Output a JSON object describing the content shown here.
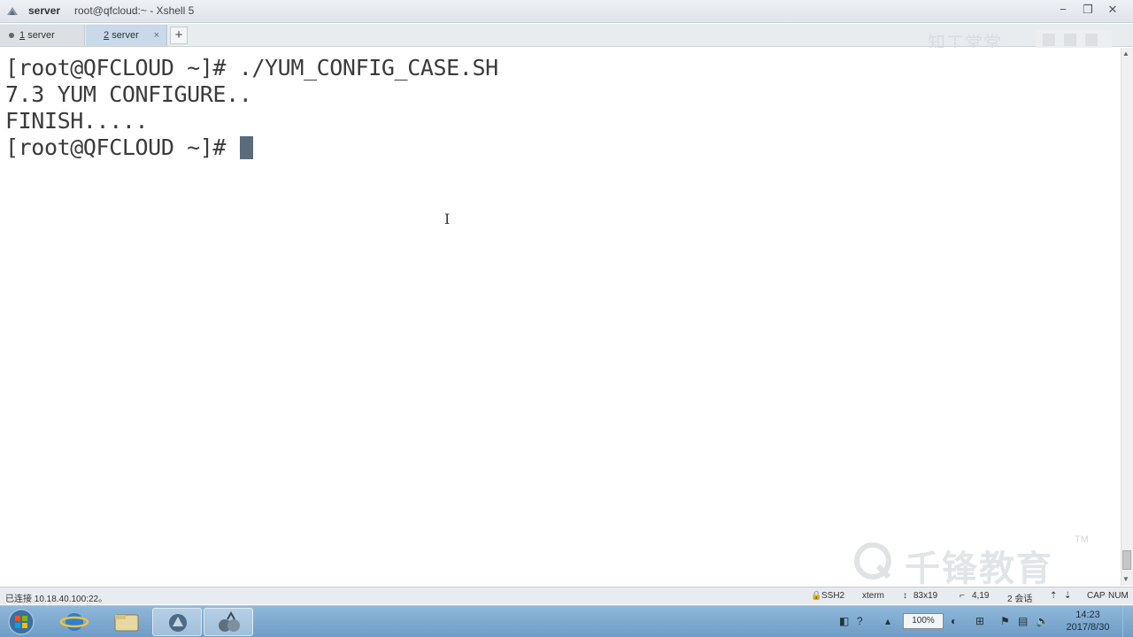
{
  "titlebar": {
    "app_name": "server",
    "window_title": "root@qfcloud:~ - Xshell 5",
    "minimize": "−",
    "restore": "❐",
    "close": "✕"
  },
  "tabs": [
    {
      "num": "1",
      "label": "server"
    },
    {
      "num": "2",
      "label": "server",
      "close": "×"
    }
  ],
  "tab_add": "+",
  "watermark_top": "知工堂堂",
  "terminal": {
    "lines": [
      "[root@QFCLOUD ~]# ./YUM_CONFIG_CASE.SH",
      "7.3 YUM CONFIGURE..",
      "FINISH.....",
      "[root@QFCLOUD ~]# "
    ]
  },
  "watermark_bottom": {
    "text": "千锋教育",
    "tm": "TM"
  },
  "statusbar": {
    "connection": "已连接 10.18.40.100:22。",
    "protocol": "SSH2",
    "term": "xterm",
    "size": "83x19",
    "cursor_pos": "4,19",
    "sessions": "2 会话",
    "caps": "CAP",
    "num": "NUM"
  },
  "taskbar": {
    "zoom": "100%",
    "time": "14:23",
    "date": "2017/8/30"
  },
  "colors": {
    "taskbar": "#7aa6cf",
    "cursor": "#5b6b7b",
    "terminal_text": "#3b3b3b"
  }
}
